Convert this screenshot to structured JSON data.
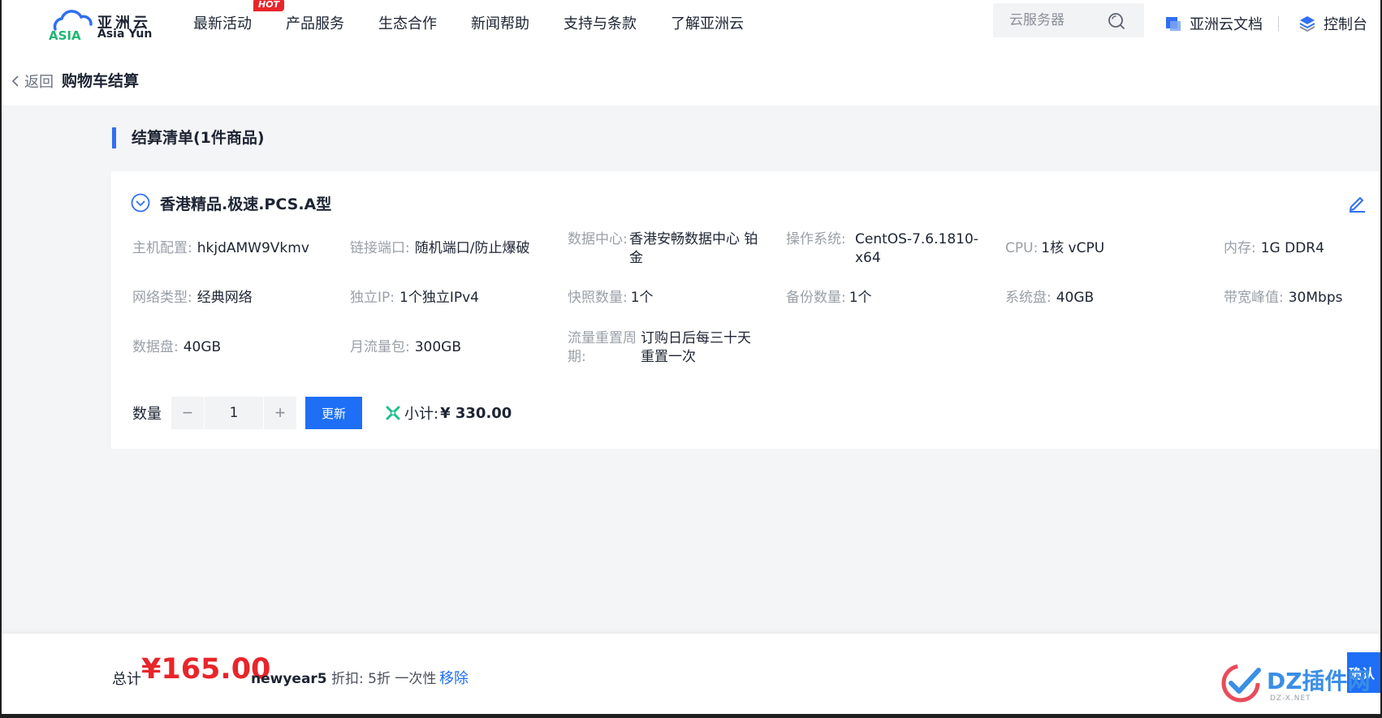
{
  "header": {
    "logo_cn": "亚洲云",
    "logo_mark": "ASIA",
    "logo_en": "Asia Yun",
    "nav": [
      {
        "label": "最新活动",
        "badge": "HOT"
      },
      {
        "label": "产品服务"
      },
      {
        "label": "生态合作"
      },
      {
        "label": "新闻帮助"
      },
      {
        "label": "支持与条款"
      },
      {
        "label": "了解亚洲云"
      }
    ],
    "search_placeholder": "云服务器",
    "docs_label": "亚洲云文档",
    "console_label": "控制台"
  },
  "subbar": {
    "back_label": "返回",
    "title": "购物车结算"
  },
  "section": {
    "title": "结算清单(1件商品)"
  },
  "product": {
    "name": "香港精品.极速.PCS.A型",
    "specs": {
      "host_label": "主机配置:",
      "host_value": "hkjdAMW9Vkmv",
      "port_label": "链接端口:",
      "port_value": "随机端口/防止爆破",
      "dc_label": "数据中心:",
      "dc_value": "香港安畅数据中心 铂金",
      "os_label": "操作系统:",
      "os_value": "CentOS-7.6.1810-x64",
      "cpu_label": "CPU:",
      "cpu_value": "1核 vCPU",
      "mem_label": "内存:",
      "mem_value": "1G DDR4",
      "net_label": "网络类型:",
      "net_value": "经典网络",
      "ip_label": "独立IP:",
      "ip_value": "1个独立IPv4",
      "snap_label": "快照数量:",
      "snap_value": "1个",
      "backup_label": "备份数量:",
      "backup_value": "1个",
      "sysdisk_label": "系统盘:",
      "sysdisk_value": "40GB",
      "bw_label": "带宽峰值:",
      "bw_value": "30Mbps",
      "datadisk_label": "数据盘:",
      "datadisk_value": "40GB",
      "traffic_label": "月流量包:",
      "traffic_value": "300GB",
      "reset_label": "流量重置周期:",
      "reset_value": "订购日后每三十天重置一次"
    },
    "qty_label": "数量",
    "qty_minus": "−",
    "qty_value": "1",
    "qty_plus": "+",
    "update_label": "更新",
    "subtotal_label": "小计:",
    "subtotal_value": "¥ 330.00"
  },
  "footer": {
    "total_label": "总计",
    "total_amount": "¥165.00",
    "coupon_code": "newyear5",
    "coupon_desc": "折扣: 5折 一次性",
    "remove_label": "移除",
    "confirm_label": "确认"
  },
  "watermark": {
    "text": "DZ插件网",
    "sub": "DZ-X.NET"
  },
  "colors": {
    "accent": "#1e6ff5",
    "price": "#e8252a",
    "hot": "#e8252a",
    "subtotal_icon": "#1fbf8f"
  },
  "icons": [
    "search-icon",
    "docs-icon",
    "console-icon",
    "chevron-left-icon",
    "chevron-down-circle-icon",
    "edit-icon",
    "subtotal-icon",
    "watermark-check-icon"
  ]
}
